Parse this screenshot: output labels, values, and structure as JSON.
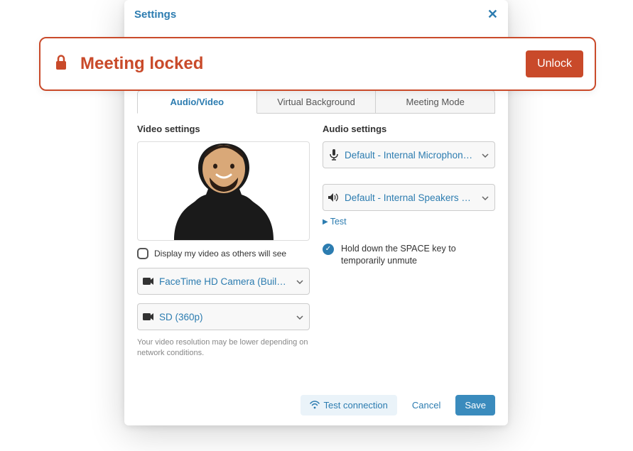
{
  "header": {
    "title": "Settings"
  },
  "banner": {
    "message": "Meeting locked",
    "unlock_label": "Unlock"
  },
  "tabs": {
    "audio_video": "Audio/Video",
    "virtual_background": "Virtual Background",
    "meeting_mode": "Meeting Mode"
  },
  "video": {
    "section_title": "Video settings",
    "display_as_others_label": "Display my video as others will see",
    "camera_select": "FaceTime HD Camera (Built-in)…",
    "resolution_select": "SD (360p)",
    "helper": "Your video resolution may be lower depending on network conditions."
  },
  "audio": {
    "section_title": "Audio settings",
    "mic_select": "Default - Internal Microphone (…",
    "speaker_select": "Default - Internal Speakers (Bu…",
    "test_label": "Test",
    "space_unmute_label": "Hold down the SPACE key to temporarily unmute"
  },
  "footer": {
    "test_connection": "Test connection",
    "cancel": "Cancel",
    "save": "Save"
  }
}
